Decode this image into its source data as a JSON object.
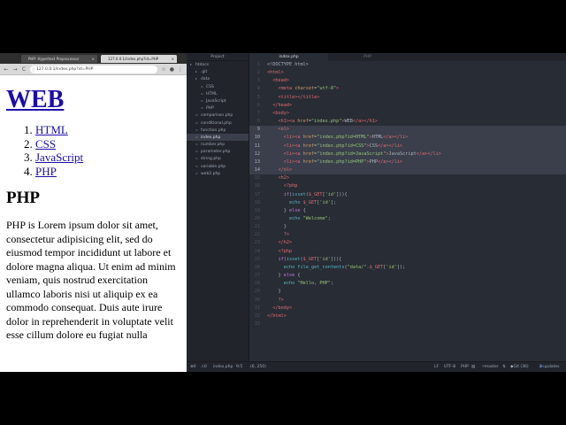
{
  "browser": {
    "tabs": [
      {
        "label": "PHP: Hypertext Preprocessor",
        "close": "×"
      },
      {
        "label": "127.0.0.1/index.php?id=PHP",
        "close": "×"
      }
    ],
    "nav": {
      "back": "←",
      "forward": "→",
      "reload": "C"
    },
    "address": "127.0.0.1/index.php?id=PHP",
    "page": {
      "heading": "WEB",
      "links": [
        "HTML",
        "CSS",
        "JavaScript",
        "PHP"
      ],
      "subheading": "PHP",
      "body": "PHP is Lorem ipsum dolor sit amet, consectetur adipisicing elit, sed do eiusmod tempor incididunt ut labore et dolore magna aliqua. Ut enim ad minim veniam, quis nostrud exercitation ullamco laboris nisi ut aliquip ex ea commodo consequat. Duis aute irure dolor in reprehenderit in voluptate velit esse cillum dolore eu fugiat nulla"
    }
  },
  "editor": {
    "tree_header": "Project",
    "tree": [
      {
        "label": "htdocs",
        "type": "dir"
      },
      {
        "label": ".git",
        "type": "dir"
      },
      {
        "label": "data",
        "type": "dir"
      },
      {
        "label": "CSS",
        "type": "file"
      },
      {
        "label": "HTML",
        "type": "file"
      },
      {
        "label": "JavaScript",
        "type": "file"
      },
      {
        "label": "PHP",
        "type": "file"
      },
      {
        "label": "comparison.php",
        "type": "file"
      },
      {
        "label": "conditional.php",
        "type": "file"
      },
      {
        "label": "function.php",
        "type": "file"
      },
      {
        "label": "index.php",
        "type": "file"
      },
      {
        "label": "number.php",
        "type": "file"
      },
      {
        "label": "parameter.php",
        "type": "file"
      },
      {
        "label": "string.php",
        "type": "file"
      },
      {
        "label": "variable.php",
        "type": "file"
      },
      {
        "label": "web2.php",
        "type": "file"
      }
    ],
    "tabs": [
      {
        "label": "index.php"
      },
      {
        "label": "PHP"
      }
    ],
    "code": [
      {
        "n": "1",
        "html": "&lt;!DOCTYPE html&gt;"
      },
      {
        "n": "2",
        "html": "<span class='tok-tag'>&lt;html&gt;</span>"
      },
      {
        "n": "3",
        "html": "  <span class='tok-tag'>&lt;head&gt;</span>"
      },
      {
        "n": "4",
        "html": "    <span class='tok-tag'>&lt;meta</span> <span class='tok-attr'>charset</span>=<span class='tok-str'>\"utf-8\"</span><span class='tok-tag'>&gt;</span>"
      },
      {
        "n": "5",
        "html": "    <span class='tok-tag'>&lt;title&gt;&lt;/title&gt;</span>"
      },
      {
        "n": "6",
        "html": "  <span class='tok-tag'>&lt;/head&gt;</span>"
      },
      {
        "n": "7",
        "html": "  <span class='tok-tag'>&lt;body&gt;</span>"
      },
      {
        "n": "8",
        "html": "    <span class='tok-tag'>&lt;h1&gt;&lt;a</span> <span class='tok-attr'>href</span>=<span class='tok-str'>\"index.php\"</span><span class='tok-tag'>&gt;</span>WEB<span class='tok-tag'>&lt;/a&gt;&lt;/h1&gt;</span>"
      },
      {
        "n": "9",
        "html": "    <span class='tok-tag'>&lt;ol&gt;</span>",
        "hl": true
      },
      {
        "n": "10",
        "html": "      <span class='tok-tag'>&lt;li&gt;&lt;a</span> <span class='tok-attr'>href</span>=<span class='tok-str'>\"index.php?id=HTML\"</span><span class='tok-tag'>&gt;</span>HTML<span class='tok-tag'>&lt;/a&gt;&lt;/li&gt;</span>",
        "hl": true
      },
      {
        "n": "11",
        "html": "      <span class='tok-tag'>&lt;li&gt;&lt;a</span> <span class='tok-attr'>href</span>=<span class='tok-str'>\"index.php?id=CSS\"</span><span class='tok-tag'>&gt;</span>CSS<span class='tok-tag'>&lt;/a&gt;&lt;/li&gt;</span>",
        "hl": true
      },
      {
        "n": "12",
        "html": "      <span class='tok-tag'>&lt;li&gt;&lt;a</span> <span class='tok-attr'>href</span>=<span class='tok-str'>\"index.php?id=JavaScript\"</span><span class='tok-tag'>&gt;</span>JavaScript<span class='tok-tag'>&lt;/a&gt;&lt;/li&gt;</span>",
        "hl": true
      },
      {
        "n": "13",
        "html": "      <span class='tok-tag'>&lt;li&gt;&lt;a</span> <span class='tok-attr'>href</span>=<span class='tok-str'>\"index.php?id=PHP\"</span><span class='tok-tag'>&gt;</span>PHP<span class='tok-tag'>&lt;/a&gt;&lt;/li&gt;</span>",
        "hl": true
      },
      {
        "n": "14",
        "html": "    <span class='tok-tag'>&lt;/ol&gt;</span>",
        "hl": true
      },
      {
        "n": "15",
        "html": "    <span class='tok-tag'>&lt;h2&gt;</span>"
      },
      {
        "n": "16",
        "html": "      <span class='tok-php'>&lt;?php</span>"
      },
      {
        "n": "17",
        "html": "      <span class='tok-kw'>if</span>(<span class='tok-fn'>isset</span>(<span class='tok-var'>$_GET</span>[<span class='tok-str'>'id'</span>])){"
      },
      {
        "n": "18",
        "html": "        <span class='tok-fn'>echo</span> <span class='tok-var'>$_GET</span>[<span class='tok-str'>'id'</span>];"
      },
      {
        "n": "19",
        "html": "      } <span class='tok-kw'>else</span> {"
      },
      {
        "n": "20",
        "html": "        <span class='tok-fn'>echo</span> <span class='tok-str'>\"Welcome\"</span>;"
      },
      {
        "n": "21",
        "html": "      }"
      },
      {
        "n": "22",
        "html": "      <span class='tok-php'>?&gt;</span>"
      },
      {
        "n": "23",
        "html": "    <span class='tok-tag'>&lt;/h2&gt;</span>"
      },
      {
        "n": "24",
        "html": "    <span class='tok-php'>&lt;?php</span>"
      },
      {
        "n": "25",
        "html": "    <span class='tok-kw'>if</span>(<span class='tok-fn'>isset</span>(<span class='tok-var'>$_GET</span>[<span class='tok-str'>'id'</span>])){"
      },
      {
        "n": "26",
        "html": "      <span class='tok-fn'>echo</span> <span class='tok-fn'>file_get_contents</span>(<span class='tok-str'>\"data/\"</span>.<span class='tok-var'>$_GET</span>[<span class='tok-str'>'id'</span>]);"
      },
      {
        "n": "27",
        "html": "    } <span class='tok-kw'>else</span> {"
      },
      {
        "n": "28",
        "html": "      <span class='tok-fn'>echo</span> <span class='tok-str'>\"Hello, PHP\"</span>;"
      },
      {
        "n": "29",
        "html": "    }"
      },
      {
        "n": "30",
        "html": "    <span class='tok-php'>?&gt;</span>"
      },
      {
        "n": "31",
        "html": "  <span class='tok-tag'>&lt;/body&gt;</span>"
      },
      {
        "n": "32",
        "html": "<span class='tok-tag'>&lt;/html&gt;</span>"
      },
      {
        "n": "33",
        "html": ""
      }
    ],
    "status": {
      "errors": "0",
      "warnings": "0",
      "file": "index.php",
      "cursor": "9:5",
      "selection": "(6, 250)",
      "line_ending": "LF",
      "encoding": "UTF-8",
      "grammar": "PHP",
      "branch": "master",
      "git": "Git (36)",
      "updates": "2 updates"
    }
  }
}
